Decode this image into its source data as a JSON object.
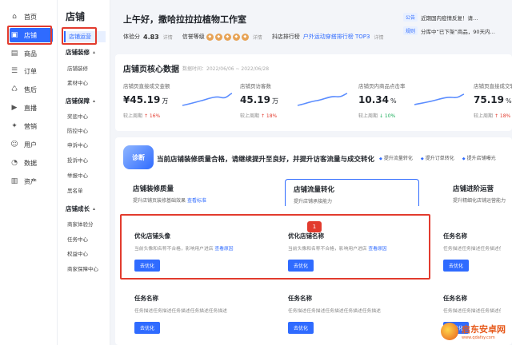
{
  "nav": [
    {
      "label": "首页",
      "icon": "home-icon",
      "glyph": "⌂"
    },
    {
      "label": "店铺",
      "icon": "store-icon",
      "glyph": "▣"
    },
    {
      "label": "商品",
      "icon": "product-icon",
      "glyph": "▤"
    },
    {
      "label": "订单",
      "icon": "order-icon",
      "glyph": "☰"
    },
    {
      "label": "售后",
      "icon": "aftersale-icon",
      "glyph": "♺"
    },
    {
      "label": "直播",
      "icon": "live-icon",
      "glyph": "▶"
    },
    {
      "label": "营销",
      "icon": "marketing-icon",
      "glyph": "✦"
    },
    {
      "label": "用户",
      "icon": "user-icon",
      "glyph": "☺"
    },
    {
      "label": "数据",
      "icon": "data-icon",
      "glyph": "◔"
    },
    {
      "label": "资产",
      "icon": "asset-icon",
      "glyph": "▥"
    }
  ],
  "subnav": {
    "title": "店铺",
    "active": "店铺运营",
    "groups": [
      {
        "label": "店铺装修",
        "items": [
          "店铺装修",
          "素材中心"
        ]
      },
      {
        "label": "店铺保障",
        "items": [
          "奖惩中心",
          "防控中心",
          "申诉中心",
          "投诉中心",
          "举报中心",
          "黑名单"
        ]
      },
      {
        "label": "店铺成长",
        "items": [
          "商家体验分",
          "任务中心",
          "权益中心",
          "商家保障中心"
        ]
      }
    ]
  },
  "header": {
    "greeting": "上午好，撒哈拉拉拉植物工作室",
    "exp_label": "体验分",
    "exp_value": "4.83",
    "detail": "详情",
    "credit_label": "信誉等级",
    "rank_label": "抖店排行榜",
    "rank_value": "户外运动穿搭排行榜 TOP3",
    "rank_detail": "详情"
  },
  "notices": [
    {
      "tag": "公告",
      "text": "近期国内疫情反复！请…"
    },
    {
      "tag": "规则",
      "text": "分库中“已下架”商品，90天内…"
    }
  ],
  "core": {
    "title": "店铺页核心数据",
    "range": "数据时间：2022/06/06 ~ 2022/06/28",
    "kpis": [
      {
        "label": "店铺页直接成交金额",
        "value": "¥45.19",
        "unit": "万",
        "trend_label": "较上周期",
        "trend": "↑ 16%",
        "dir": "up"
      },
      {
        "label": "店铺页访客数",
        "value": "45.19",
        "unit": "万",
        "trend_label": "较上周期",
        "trend": "↑ 18%",
        "dir": "up"
      },
      {
        "label": "店铺页内商品点击率",
        "value": "10.34",
        "unit": "%",
        "trend_label": "较上周期",
        "trend": "↓ 10%",
        "dir": "down"
      },
      {
        "label": "店铺页直接成交转化率",
        "value": "75.19",
        "unit": "%",
        "trend_label": "较上周期",
        "trend": "↑ 18%",
        "dir": "up"
      }
    ]
  },
  "diagnosis": {
    "badge": "诊断",
    "headline": "当前店铺装修质量合格，请继续提升至良好，并提升访客流量与成交转化",
    "tags": [
      "提升流量转化",
      "提升订单转化",
      "提升店铺曝光"
    ],
    "tabs": [
      {
        "title": "店铺装修质量",
        "sub": "提升店铺页装修基础效果",
        "link": "查看标准"
      },
      {
        "title": "店铺流量转化",
        "sub": "提升店铺承接能力",
        "link": ""
      },
      {
        "title": "店铺进阶运营",
        "sub": "提升精细化店铺运营能力",
        "link": ""
      }
    ],
    "marker": "1",
    "tasks": [
      {
        "title": "优化店铺头像",
        "desc": "当前头像和名称不合格，影响用户进店",
        "link": "查看原因",
        "button": "去优化"
      },
      {
        "title": "优化店铺名称",
        "desc": "当前头像和名称不合格，影响用户进店",
        "link": "查看原因",
        "button": "去优化"
      },
      {
        "title": "任务名称",
        "desc": "任务描述任务描述任务描述任务",
        "link": "",
        "button": "去优化"
      },
      {
        "title": "任务名称",
        "desc": "任务描述任务描述任务描述任务描述任务描述",
        "link": "",
        "button": "去优化"
      },
      {
        "title": "任务名称",
        "desc": "任务描述任务描述任务描述任务描述任务描述",
        "link": "",
        "button": "去优化"
      },
      {
        "title": "任务名称",
        "desc": "任务描述任务描述任务描述任务",
        "link": "",
        "button": "去优化"
      }
    ]
  },
  "watermark": {
    "title": "启东安卓网",
    "sub": "www.qdafsy.com"
  },
  "colors": {
    "accent": "#2f6bff",
    "highlight": "#e23b2e",
    "up": "#e23b2e",
    "down": "#1aad5a"
  }
}
